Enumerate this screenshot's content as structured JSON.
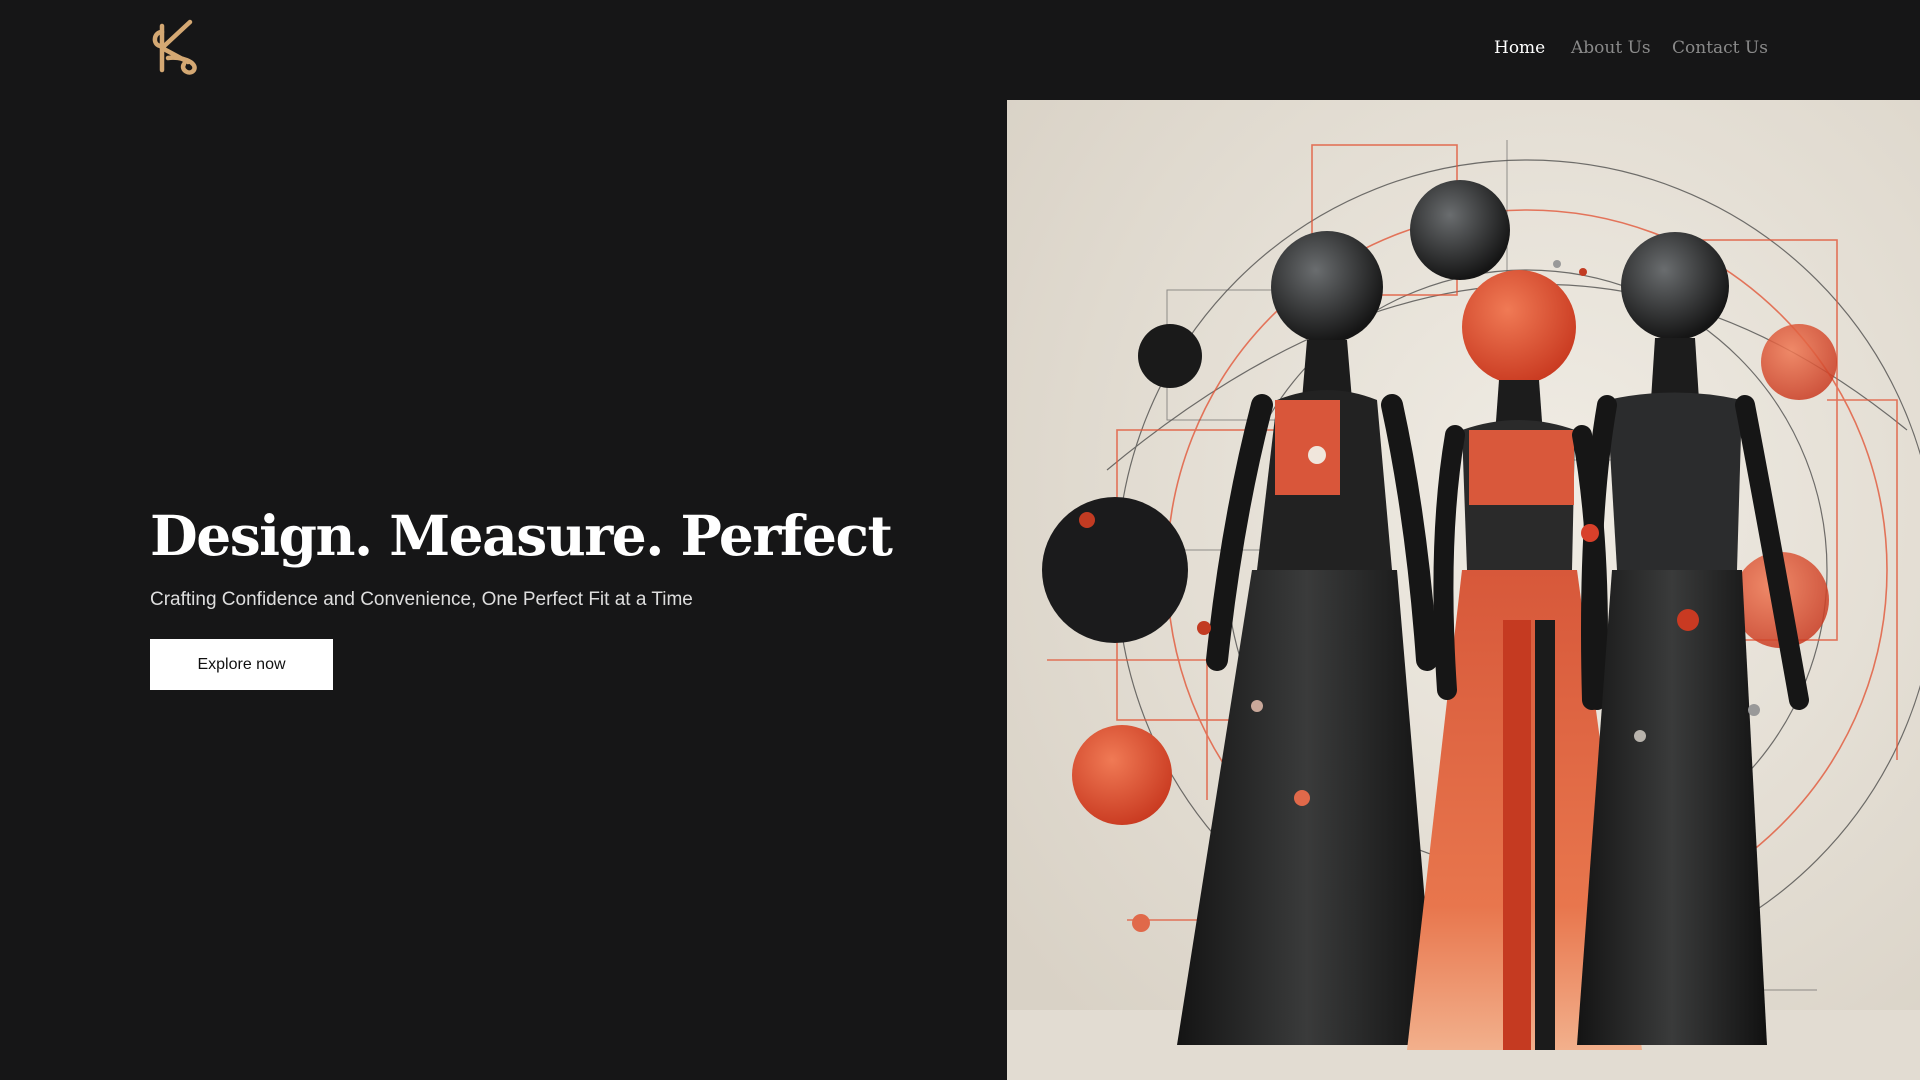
{
  "brand": {
    "logo_icon": "monogram-k-icon",
    "accent_color": "#d4a873"
  },
  "nav": {
    "items": [
      {
        "label": "Home",
        "active": true
      },
      {
        "label": "About Us",
        "active": false
      },
      {
        "label": "Contact Us",
        "active": false
      }
    ]
  },
  "hero": {
    "title": "Design. Measure. Perfect",
    "subtitle": "Crafting Confidence and Convenience, One Perfect Fit at a Time",
    "cta_label": "Explore now",
    "image_icon": "mannequin-artwork-image"
  },
  "colors": {
    "background": "#161617",
    "text": "#ffffff",
    "muted": "#8a8a8a",
    "art_bg": "#e6e1d8",
    "art_orange": "#e25a3a",
    "art_dark": "#1d1d1f"
  }
}
